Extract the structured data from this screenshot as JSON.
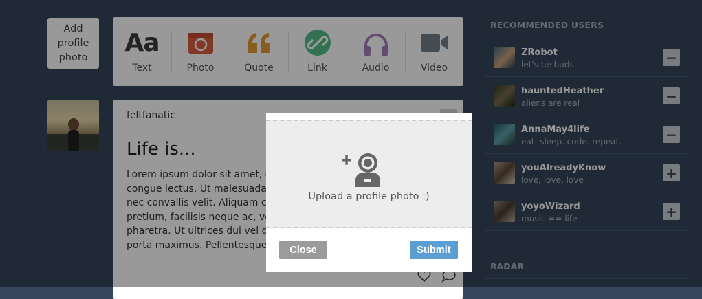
{
  "left": {
    "add_photo_label": "Add\nprofile\nphoto"
  },
  "post_types": [
    {
      "label": "Text",
      "icon": "text-icon"
    },
    {
      "label": "Photo",
      "icon": "camera-icon"
    },
    {
      "label": "Quote",
      "icon": "quote-icon"
    },
    {
      "label": "Link",
      "icon": "link-icon"
    },
    {
      "label": "Audio",
      "icon": "headphones-icon"
    },
    {
      "label": "Video",
      "icon": "video-camera-icon"
    }
  ],
  "post_type_glyph_text": "Aa",
  "post": {
    "username": "feltfanatic",
    "title": "Life is...",
    "body": "Lorem ipsum dolor sit amet, c\ncongue lectus. Ut malesuada \nnec convallis velit. Aliquam c\npretium, facilisis neque ac, ve\npharetra. Ut ultrices dui vel d\nporta maximus. Pellentesque"
  },
  "sidebar": {
    "title": "RECOMMENDED USERS",
    "users": [
      {
        "name": "ZRobot",
        "tagline": "let's be buds",
        "action": "−"
      },
      {
        "name": "hauntedHeather",
        "tagline": "aliens are real",
        "action": "−"
      },
      {
        "name": "AnnaMay4life",
        "tagline": "eat. sleep. code. repeat.",
        "action": "−"
      },
      {
        "name": "youAlreadyKnow",
        "tagline": "love, love, love",
        "action": "+"
      },
      {
        "name": "yoyoWizard",
        "tagline": "music == life",
        "action": "+"
      }
    ],
    "radar_title": "RADAR"
  },
  "modal": {
    "upload_text": "Upload a profile photo :)",
    "close_label": "Close",
    "submit_label": "Submit"
  },
  "colors": {
    "background": "#36465d",
    "photo_red": "#d95e40",
    "quote_orange": "#e59a3a",
    "link_green": "#56bc8a",
    "audio_purple": "#a77dc2",
    "video_gray": "#748089",
    "submit_blue": "#5b9ed3",
    "close_gray": "#9b9b9b"
  }
}
